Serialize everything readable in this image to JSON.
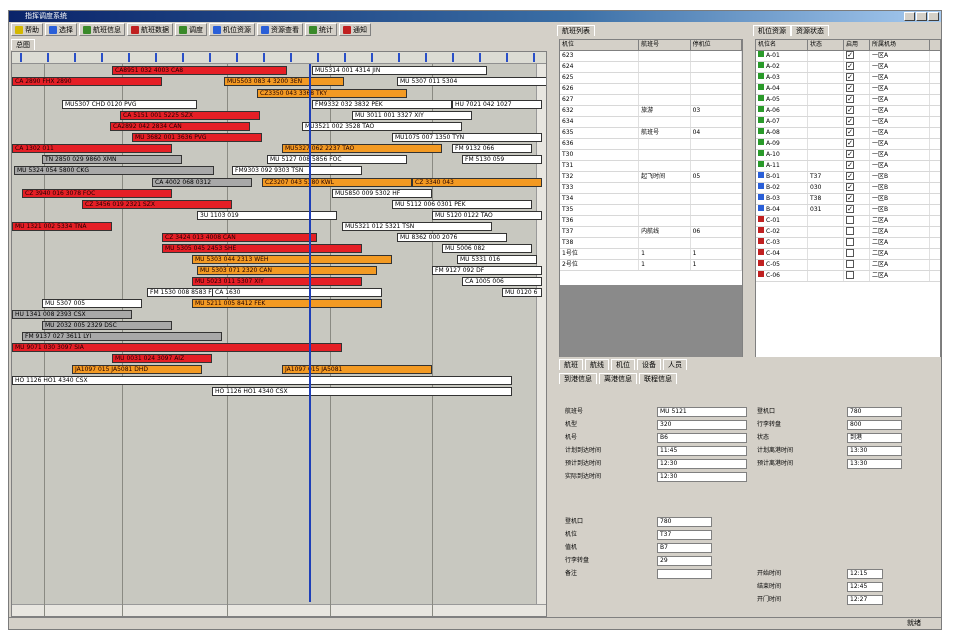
{
  "title": "指挥调度系统",
  "toolbar": {
    "items": [
      "帮助",
      "选择",
      "航班信息",
      "航班数据",
      "调度",
      "机位资源",
      "资源查看",
      "统计",
      "通知"
    ],
    "gantt_tab": "总图"
  },
  "gantt": {
    "bars": [
      {
        "t": "CA8951 032 4003 CA8",
        "c": "r"
      },
      {
        "t": "MU5314 001 4314 JIN",
        "c": "w"
      },
      {
        "t": "CA 2890 FHX 2890",
        "c": "r"
      },
      {
        "t": "MU5503 083 4 3200 3EN",
        "c": "o"
      },
      {
        "t": "MU 5307 011 5304",
        "c": "w"
      },
      {
        "t": "CZ3350 043 3368 TKY",
        "c": "o"
      },
      {
        "t": "MU5307 CHD 0120 PVG",
        "c": "w"
      },
      {
        "t": "FM9332 032 3832 PEK",
        "c": "w"
      },
      {
        "t": "HU 7021 042 1027",
        "c": "w"
      },
      {
        "t": "CA 5151 001 5225 SZX",
        "c": "r"
      },
      {
        "t": "MU 3011 001 3327 XIY",
        "c": "w"
      },
      {
        "t": "CA2892 042 2834 CAN",
        "c": "r"
      },
      {
        "t": "MU3521 002 3528 TAO",
        "c": "w"
      },
      {
        "t": "MU 3682 001 3636 PVG",
        "c": "r"
      },
      {
        "t": "MU1075 007 1350 TYN",
        "c": "w"
      },
      {
        "t": "CA 1302 011",
        "c": "r"
      },
      {
        "t": "MU5327 062 2237 TAO",
        "c": "o"
      },
      {
        "t": "FM 9132 066",
        "c": "w"
      },
      {
        "t": "TN 2850 029 9860 XMN",
        "c": "g"
      },
      {
        "t": "MU 5127 008 5856 FOC",
        "c": "w"
      },
      {
        "t": "FM 5130 059",
        "c": "w"
      },
      {
        "t": "MU 5324 054 5800 CKG",
        "c": "g"
      },
      {
        "t": "FM9303 092 9303 TSN",
        "c": "w"
      },
      {
        "t": "CA 4002 068 0312",
        "c": "g"
      },
      {
        "t": "CZ3207 043 5380 KWL",
        "c": "o"
      },
      {
        "t": "CZ 3340 043",
        "c": "o"
      },
      {
        "t": "CZ 3940 016 3078 FOC",
        "c": "r"
      },
      {
        "t": "MU5850 009 5302 HF",
        "c": "w"
      },
      {
        "t": "CZ 3456 019 2321 SZX",
        "c": "r"
      },
      {
        "t": "MU 5112 006 0301 PEK",
        "c": "w"
      },
      {
        "t": "MU 5120 0122 TAO",
        "c": "w"
      },
      {
        "t": "3U 1103 019",
        "c": "w"
      },
      {
        "t": "HO1252 009 HO1252 WUX",
        "c": "w"
      },
      {
        "t": "MU 1321 002 5334 TNA",
        "c": "r"
      },
      {
        "t": "MU5321 012 5321 TSN",
        "c": "w"
      },
      {
        "t": "CZ 3424 013 4008 CAN",
        "c": "r"
      },
      {
        "t": "MU 8362 000 2076",
        "c": "w"
      },
      {
        "t": "MU 5305 045 2453 SHE",
        "c": "r"
      },
      {
        "t": "MU 5006 082",
        "c": "w"
      },
      {
        "t": "MU 5303 044 2313 WEH",
        "c": "o"
      },
      {
        "t": "MU 5331 016",
        "c": "w"
      },
      {
        "t": "MU 5303 071 2320 CAN",
        "c": "o"
      },
      {
        "t": "FM 9127 092 DF",
        "c": "w"
      },
      {
        "t": "MU 5023 011 5307 XIY",
        "c": "r"
      },
      {
        "t": "CA 1005 006",
        "c": "w"
      },
      {
        "t": "FM 1530 008 8583 FOC",
        "c": "w"
      },
      {
        "t": "CA 1630",
        "c": "w"
      },
      {
        "t": "MU 0120 6",
        "c": "w"
      },
      {
        "t": "MU 5211 005 8412 FEK",
        "c": "o"
      },
      {
        "t": "MU 5307 005",
        "c": "w"
      },
      {
        "t": "HU 1341 008 2393 CSX",
        "c": "g"
      },
      {
        "t": "MU 2032 005 2329 DSC",
        "c": "g"
      },
      {
        "t": "FM 9137 027 3611 LYI",
        "c": "g"
      },
      {
        "t": "MU 9071 030 3097 SIA",
        "c": "r"
      },
      {
        "t": "MU 0031 024 3097 AIZ",
        "c": "r"
      },
      {
        "t": "JA1097 015 JA5081 DHD",
        "c": "o"
      },
      {
        "t": "JA1097 015 JA5081",
        "c": "o"
      },
      {
        "t": "HO 1126 HO1 4340 CSX",
        "c": "w"
      },
      {
        "t": "HO 1126 HO1 4340 CSX",
        "c": "w"
      }
    ]
  },
  "flights": {
    "tab": "航班列表",
    "cols": [
      "机位",
      "航班号",
      "停机位"
    ],
    "rows": [
      [
        "623",
        "",
        ""
      ],
      [
        "624",
        "",
        ""
      ],
      [
        "625",
        "",
        ""
      ],
      [
        "626",
        "",
        ""
      ],
      [
        "627",
        "",
        ""
      ],
      [
        "632",
        "旅游",
        "03"
      ],
      [
        "634",
        "",
        ""
      ],
      [
        "635",
        "航班号",
        "04"
      ],
      [
        "636",
        "",
        ""
      ],
      [
        "T30",
        "",
        ""
      ],
      [
        "T31",
        "",
        ""
      ],
      [
        "T32",
        "起飞时间",
        "05"
      ],
      [
        "T33",
        "",
        ""
      ],
      [
        "T34",
        "",
        ""
      ],
      [
        "T35",
        "",
        ""
      ],
      [
        "T36",
        "",
        ""
      ],
      [
        "T37",
        "内航线",
        "06"
      ],
      [
        "T38",
        "",
        ""
      ],
      [
        "1号位",
        "1",
        "1"
      ],
      [
        "2号位",
        "1",
        "1"
      ]
    ]
  },
  "resources": {
    "tabs": [
      "机位资源",
      "资源状态"
    ],
    "cols": [
      "机位名",
      "状态",
      "启用",
      "所属机场"
    ],
    "rows": [
      [
        "A-01",
        "",
        "一区A"
      ],
      [
        "A-02",
        "",
        "一区A"
      ],
      [
        "A-03",
        "",
        "一区A"
      ],
      [
        "A-04",
        "",
        "一区A"
      ],
      [
        "A-05",
        "",
        "一区A"
      ],
      [
        "A-06",
        "",
        "一区A"
      ],
      [
        "A-07",
        "",
        "一区A"
      ],
      [
        "A-08",
        "",
        "一区A"
      ],
      [
        "A-09",
        "",
        "一区A"
      ],
      [
        "A-10",
        "",
        "一区A"
      ],
      [
        "A-11",
        "",
        "一区A"
      ],
      [
        "B-01",
        "T37",
        "一区B"
      ],
      [
        "B-02",
        "030",
        "一区B"
      ],
      [
        "B-03",
        "T38",
        "一区B"
      ],
      [
        "B-04",
        "031",
        "一区B"
      ],
      [
        "C-01",
        "",
        "二区A"
      ],
      [
        "C-02",
        "",
        "二区A"
      ],
      [
        "C-03",
        "",
        "二区A"
      ],
      [
        "C-04",
        "",
        "二区A"
      ],
      [
        "C-05",
        "",
        "二区A"
      ],
      [
        "C-06",
        "",
        "二区A"
      ]
    ]
  },
  "detail": {
    "tabs": [
      "航班",
      "航线",
      "机位",
      "设备",
      "人员"
    ],
    "subtabs": [
      "到港信息",
      "离港信息",
      "联程信息"
    ],
    "left": [
      [
        "航班号",
        "MU 5121"
      ],
      [
        "机型",
        "320"
      ],
      [
        "机号",
        "B6"
      ],
      [
        "计划到达时间",
        "11:45"
      ],
      [
        "预计到达时间",
        "12:30"
      ],
      [
        "实际到达时间",
        "12:30"
      ]
    ],
    "right": [
      [
        "登机口",
        "780"
      ],
      [
        "行李转盘",
        "800"
      ],
      [
        "状态",
        "到港"
      ],
      [
        "计划离港时间",
        "13:30"
      ],
      [
        "预计离港时间",
        "13:30"
      ]
    ],
    "lower": [
      [
        "登机口",
        "780"
      ],
      [
        "机位",
        "T37"
      ],
      [
        "值机",
        "B7"
      ],
      [
        "行李转盘",
        "29"
      ],
      [
        "备注",
        ""
      ]
    ],
    "lower_right": [
      [
        "开始时间",
        "12:15"
      ],
      [
        "结束时间",
        "12:45"
      ],
      [
        "开门时间",
        "12:27"
      ]
    ]
  },
  "status": "就绪"
}
